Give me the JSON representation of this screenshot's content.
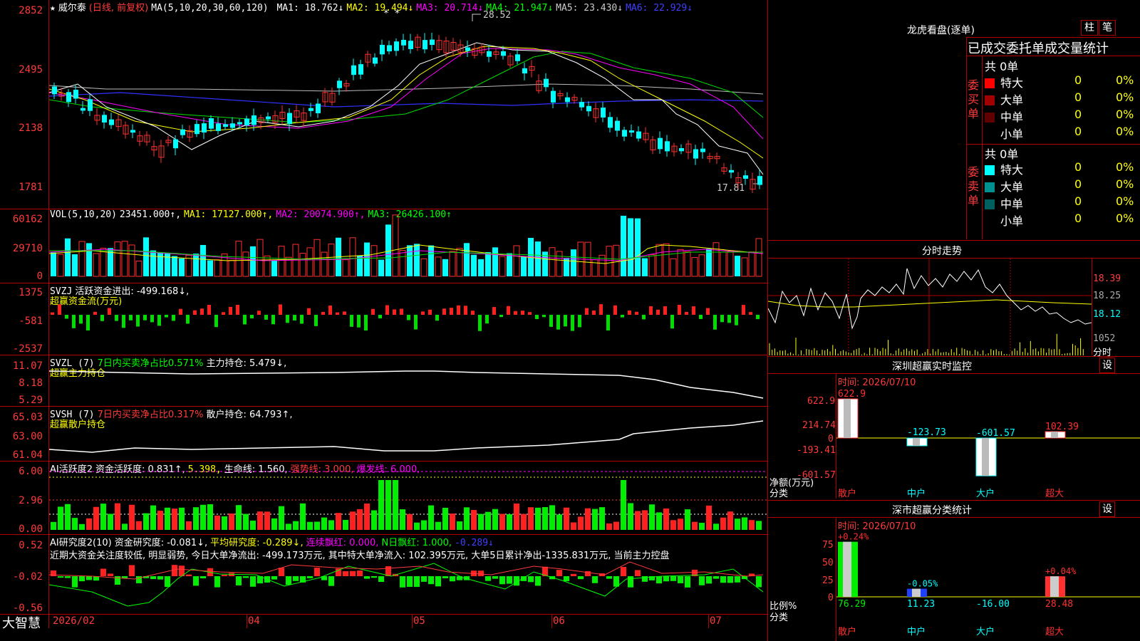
{
  "stock": {
    "name": "威尔泰",
    "mode": "(日线, 前复权)",
    "ma_params": "MA(5,10,20,30,60,120)",
    "ma": [
      {
        "label": "MA1:",
        "value": "18.762↓",
        "color": "#ffffff"
      },
      {
        "label": "MA2:",
        "value": "19.494↓",
        "color": "#ffff00"
      },
      {
        "label": "MA3:",
        "value": "20.714↓",
        "color": "#ff00ff"
      },
      {
        "label": "MA4:",
        "value": "21.947↓",
        "color": "#00ff00"
      },
      {
        "label": "MA5:",
        "value": "23.430↓",
        "color": "#cccccc"
      },
      {
        "label": "MA6:",
        "value": "22.929↓",
        "color": "#4040ff"
      }
    ],
    "price_axis": [
      "2852",
      "2495",
      "2138",
      "1781"
    ],
    "high_label": "28.52",
    "low_label": "17.81",
    "star_marks": "* *"
  },
  "vol": {
    "title": "VOL(5,10,20)",
    "value": "23451.000↑,",
    "ma": [
      {
        "label": "MA1:",
        "value": "17127.000↑,",
        "color": "#ffff00"
      },
      {
        "label": "MA2:",
        "value": "20074.900↑,",
        "color": "#ff00ff"
      },
      {
        "label": "MA3:",
        "value": "26426.100↑",
        "color": "#00ff00"
      }
    ],
    "axis": [
      "60162",
      "29710",
      "0"
    ]
  },
  "svzj": {
    "title": "SVZJ",
    "text": "活跃资金进出: -499.168↓,",
    "sub": "超赢资金流(万元)",
    "axis": [
      "1375",
      "-581",
      "-2537"
    ]
  },
  "svzl": {
    "title": "SVZL (7)",
    "text1": "7日内买卖净占比0.571%",
    "text2": "主力持仓: 5.479↓,",
    "sub": "超赢主力持仓",
    "axis": [
      "11.07",
      "8.18",
      "5.29"
    ]
  },
  "svsh": {
    "title": "SVSH (7)",
    "text1": "7日内买卖净占比0.317%",
    "text2": "散户持仓: 64.793↑,",
    "sub": "超赢散户持仓",
    "axis": [
      "65.03",
      "63.00",
      "61.04"
    ]
  },
  "ai1": {
    "title": "AI活跃度2",
    "t1": "资金活跃度: 0.831↑,",
    "t2": "5.398,",
    "t3": "生命线: 1.560,",
    "t4": "强势线: 3.000,",
    "t5": "爆发线: 6.000,",
    "axis": [
      "6.00",
      "2.96",
      "0.00"
    ]
  },
  "ai2": {
    "title": "AI研究度2(10)",
    "t1": "资金研究度: -0.081↓,",
    "t2": "平均研究度: -0.289↓,",
    "t3": "连续飘红: 0.000,",
    "t4": "N日飘红: 1.000,",
    "t5": "-0.289↓",
    "comment": "近期大资金关注度较低, 明显弱势, 今日大单净流出: -499.173万元, 其中特大单净流入: 102.395万元, 大单5日累计净出-1335.831万元, 当前主力控盘",
    "axis": [
      "0.52",
      "-0.02",
      "-0.56"
    ]
  },
  "xaxis": {
    "brand": "大智慧",
    "labels": [
      "2026/02",
      "04",
      "05",
      "06",
      "07"
    ]
  },
  "right": {
    "lhb_title": "龙虎看盘(逐单)",
    "btn_bar": "柱",
    "btn_pen": "笔",
    "stats_title": "已成交委托单成交量统计",
    "buy_label": "委买单",
    "sell_label": "委卖单",
    "buy_total": "共 0单",
    "sell_total": "共 0单",
    "buy_rows": [
      {
        "name": "特大",
        "count": "0",
        "pct": "0%",
        "color": "#ff0000"
      },
      {
        "name": "大单",
        "count": "0",
        "pct": "0%",
        "color": "#a00000"
      },
      {
        "name": "中单",
        "count": "0",
        "pct": "0%",
        "color": "#600000"
      },
      {
        "name": "小单",
        "count": "0",
        "pct": "0%",
        "color": "#000000"
      }
    ],
    "sell_rows": [
      {
        "name": "特大",
        "count": "0",
        "pct": "0%",
        "color": "#00ffff"
      },
      {
        "name": "大单",
        "count": "0",
        "pct": "0%",
        "color": "#009090"
      },
      {
        "name": "中单",
        "count": "0",
        "pct": "0%",
        "color": "#006060"
      },
      {
        "name": "小单",
        "count": "0",
        "pct": "0%",
        "color": "#000000"
      }
    ],
    "intraday_title": "分时走势",
    "intraday_axis": [
      "18.39",
      "18.25",
      "18.12"
    ],
    "intraday_vol": "1052",
    "intraday_unit": "分时",
    "monitor_title": "深圳超赢实时监控",
    "monitor_btn": "设",
    "monitor_time": "时间: 2026/07/10",
    "monitor_axis": [
      "622.9",
      "214.74",
      "0",
      "-193.41",
      "-601.57"
    ],
    "monitor_ylabel": "净额(万元)",
    "monitor_xlabel": "分类",
    "monitor_cats": [
      "散户",
      "中户",
      "大户",
      "超大"
    ],
    "monitor_values": [
      "622.9",
      "-123.73",
      "-601.57",
      "102.39"
    ],
    "cls_title": "深市超赢分类统计",
    "cls_btn": "设",
    "cls_time": "时间: 2026/07/10",
    "cls_axis": [
      "75",
      "50",
      "25",
      "0"
    ],
    "cls_ylabel": "比例%",
    "cls_xlabel": "分类",
    "cls_cats": [
      "散户",
      "中户",
      "大户",
      "超大"
    ],
    "cls_top": [
      "+0.24%",
      "-0.05%",
      "",
      "+0.04%"
    ],
    "cls_values": [
      "76.29",
      "11.23",
      "-16.00",
      "28.48"
    ]
  }
}
